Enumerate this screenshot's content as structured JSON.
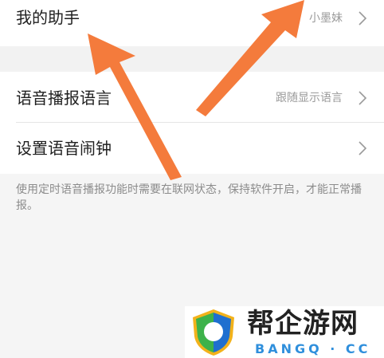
{
  "rows": [
    {
      "label": "我的助手",
      "value": "小墨妹"
    },
    {
      "label": "语音播报语言",
      "value": "跟随显示语言"
    },
    {
      "label": "设置语音闹钟",
      "value": ""
    }
  ],
  "note": "使用定时语音播报功能时需要在联网状态，保持软件开启，才能正常播报。",
  "watermark": {
    "brand": "帮企游网",
    "domain": "BANGQ · CC"
  },
  "colors": {
    "arrow": "#f47b3c",
    "background": "#f5f5f5",
    "row": "#ffffff"
  },
  "icons": {
    "chevron": "chevron-right-icon",
    "arrow": "annotation-arrow"
  }
}
